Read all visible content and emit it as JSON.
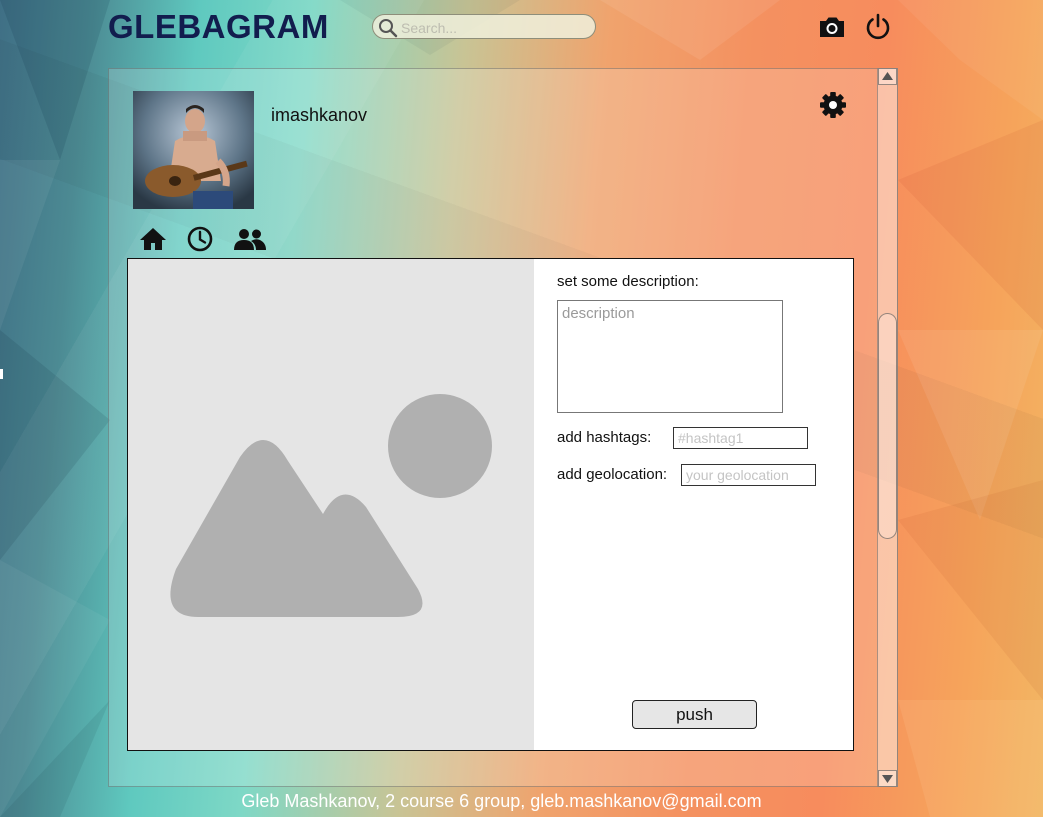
{
  "header": {
    "logo": "GLEBAGRAM",
    "search_placeholder": "Search...",
    "icons": [
      "camera-icon",
      "power-icon"
    ]
  },
  "profile": {
    "username": "imashkanov",
    "avatar": "user-photo-guitar",
    "nav_icons": [
      "home-icon",
      "clock-icon",
      "people-icon"
    ]
  },
  "post_form": {
    "description_label": "set some description:",
    "description_placeholder": "description",
    "hashtags_label": "add hashtags:",
    "hashtags_placeholder": "#hashtag1",
    "geolocation_label": "add geolocation:",
    "geolocation_placeholder": "your geolocation",
    "push_label": "push",
    "image_placeholder_icon": "image-placeholder-icon"
  },
  "footer": {
    "text": "Gleb Mashkanov, 2 course 6 group, gleb.mashkanov@gmail.com"
  },
  "colors": {
    "logo": "#121d4e",
    "placeholder_bg": "#e5e5e5",
    "placeholder_shapes": "#b0b0b0"
  }
}
